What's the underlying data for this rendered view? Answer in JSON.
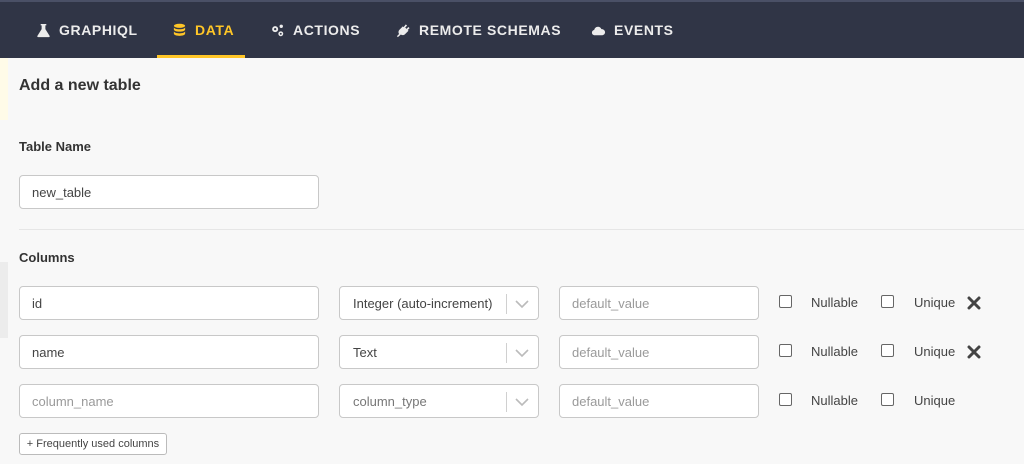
{
  "nav": {
    "items": [
      {
        "label": "GRAPHIQL",
        "icon": "flask-icon"
      },
      {
        "label": "DATA",
        "icon": "database-icon",
        "active": true
      },
      {
        "label": "ACTIONS",
        "icon": "gears-icon"
      },
      {
        "label": "REMOTE SCHEMAS",
        "icon": "plug-icon"
      },
      {
        "label": "EVENTS",
        "icon": "cloud-icon"
      }
    ],
    "active_color": "#ffc627",
    "bg_color": "#303546"
  },
  "page": {
    "title": "Add a new table",
    "table_name_label": "Table Name",
    "table_name_value": "new_table",
    "columns_label": "Columns"
  },
  "columns": [
    {
      "name": "id",
      "type": "Integer (auto-increment)",
      "default_placeholder": "default_value",
      "nullable_label": "Nullable",
      "unique_label": "Unique",
      "removable": true
    },
    {
      "name": "name",
      "type": "Text",
      "default_placeholder": "default_value",
      "nullable_label": "Nullable",
      "unique_label": "Unique",
      "removable": true
    },
    {
      "name_placeholder": "column_name",
      "type_placeholder": "column_type",
      "default_placeholder": "default_value",
      "nullable_label": "Nullable",
      "unique_label": "Unique",
      "removable": false
    }
  ],
  "frequently_used_button": "+ Frequently used columns"
}
